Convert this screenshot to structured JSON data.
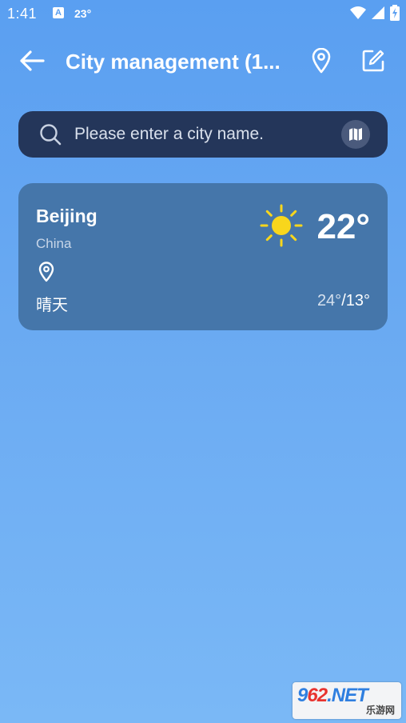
{
  "status_bar": {
    "time": "1:41",
    "notification_icon_letter": "A",
    "temperature": "23°",
    "icons": [
      "wifi-icon",
      "signal-icon",
      "battery-charging-icon"
    ]
  },
  "app_bar": {
    "title": "City management (1...",
    "back_icon": "arrow-left-icon",
    "location_icon": "map-pin-icon",
    "edit_icon": "edit-icon"
  },
  "search": {
    "placeholder": "Please enter a city name.",
    "value": "",
    "search_icon": "search-icon",
    "map_icon": "map-icon"
  },
  "cities": [
    {
      "name": "Beijing",
      "country": "China",
      "is_current_location": true,
      "condition": "晴天",
      "weather_icon": "sun-icon",
      "current_temp": "22°",
      "high": "24°",
      "separator": "/",
      "low": "13°"
    }
  ],
  "watermark": {
    "main_prefix": "9",
    "main_red": "62",
    "main_suffix": ".NET",
    "sub": "乐游网"
  },
  "colors": {
    "background_top": "#5a9ff1",
    "background_bottom": "#7ab8f6",
    "search_bar": "#24365a",
    "card": "#4576aa",
    "sun": "#f8d61c"
  }
}
